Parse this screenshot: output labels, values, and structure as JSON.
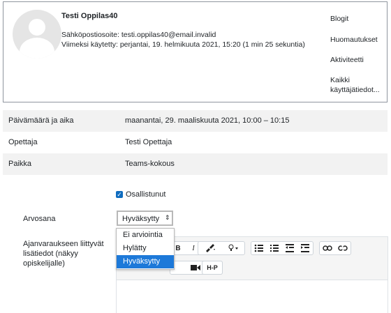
{
  "profile": {
    "name": "Testi Oppilas40",
    "email_label": "Sähköpostiosoite:",
    "email": "testi.oppilas40@email.invalid",
    "last_access": "Viimeksi käytetty: perjantai, 19. helmikuuta 2021, 15:20  (1 min 25 sekuntia)",
    "links": [
      "Blogit",
      "Huomautukset",
      "Aktiviteetti",
      "Kaikki",
      "käyttäjätiedot..."
    ]
  },
  "details": [
    {
      "label": "Päivämäärä ja aika",
      "value": "maanantai, 29. maaliskuuta 2021, 10:00 – 10:15"
    },
    {
      "label": "Opettaja",
      "value": "Testi Opettaja"
    },
    {
      "label": "Paikka",
      "value": "Teams-kokous"
    }
  ],
  "form": {
    "attended_label": "Osallistunut",
    "grade_label": "Arvosana",
    "grade_selected": "Hyväksytty",
    "grade_options": [
      "Ei arviointia",
      "Hylätty",
      "Hyväksytty"
    ],
    "notes_label": "Ajanvaraukseen liittyvät lisätiedot (näkyy opiskelijalle)"
  },
  "toolbar": {
    "bold": "B",
    "italic": "I",
    "h5p": "H-P"
  }
}
